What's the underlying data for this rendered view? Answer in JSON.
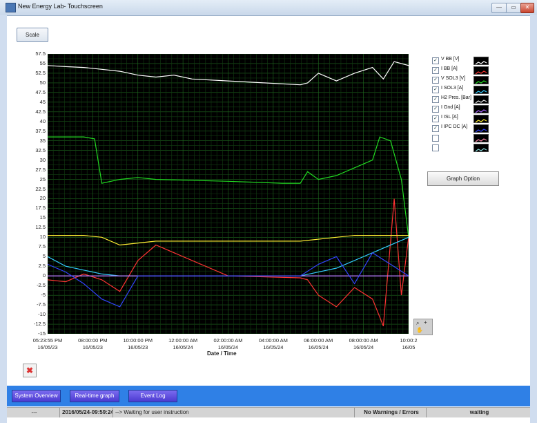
{
  "window": {
    "title": "New Energy Lab- Touchscreen",
    "min": "—",
    "max": "▭",
    "close": "✕"
  },
  "toolbar": {
    "scale_label": "Scale"
  },
  "chart_data": {
    "type": "line",
    "xlabel": "Date / Time",
    "ylim": [
      -15,
      57.5
    ],
    "yticks": [
      "57.5",
      "55",
      "52.5",
      "50",
      "47.5",
      "45",
      "42.5",
      "40",
      "37.5",
      "35",
      "32.5",
      "30",
      "27.5",
      "25",
      "22.5",
      "20",
      "17.5",
      "15",
      "12.5",
      "10",
      "7.5",
      "5",
      "2.5",
      "0",
      "-2.5",
      "-5",
      "-7.5",
      "-10",
      "-12.5",
      "-15"
    ],
    "xticks": [
      {
        "time": "05:23:55 PM",
        "date": "16/05/23"
      },
      {
        "time": "08:00:00 PM",
        "date": "16/05/23"
      },
      {
        "time": "10:00:00 PM",
        "date": "16/05/23"
      },
      {
        "time": "12:00:00 AM",
        "date": "16/05/24"
      },
      {
        "time": "02:00:00 AM",
        "date": "16/05/24"
      },
      {
        "time": "04:00:00 AM",
        "date": "16/05/24"
      },
      {
        "time": "06:00:00 AM",
        "date": "16/05/24"
      },
      {
        "time": "08:00:00 AM",
        "date": "16/05/24"
      },
      {
        "time": "10:00:2",
        "date": "16/05"
      }
    ],
    "series": [
      {
        "name": "V BB [V]",
        "color": "#ffffff",
        "x": [
          0,
          0.05,
          0.1,
          0.15,
          0.2,
          0.25,
          0.3,
          0.35,
          0.4,
          0.5,
          0.6,
          0.7,
          0.72,
          0.75,
          0.8,
          0.85,
          0.9,
          0.93,
          0.96,
          1.0
        ],
        "values": [
          54.5,
          54.2,
          54.0,
          53.5,
          53.0,
          52.0,
          51.5,
          52.0,
          51.0,
          50.5,
          50.0,
          49.5,
          50.0,
          52.5,
          50.5,
          52.5,
          54.0,
          51.0,
          55.5,
          54.5
        ]
      },
      {
        "name": "I BB [A]",
        "color": "#ff3333",
        "x": [
          0,
          0.05,
          0.1,
          0.15,
          0.2,
          0.25,
          0.3,
          0.5,
          0.7,
          0.72,
          0.75,
          0.8,
          0.85,
          0.9,
          0.93,
          0.96,
          0.98,
          1.0
        ],
        "values": [
          -1,
          -1.5,
          0.5,
          -1,
          -4,
          4,
          8,
          0,
          -0.5,
          -1,
          -5,
          -8,
          -3,
          -6,
          -13,
          20,
          -5,
          10
        ]
      },
      {
        "name": "V SOL3 [V]",
        "color": "#22dd22",
        "x": [
          0,
          0.05,
          0.1,
          0.13,
          0.15,
          0.2,
          0.25,
          0.3,
          0.5,
          0.65,
          0.7,
          0.72,
          0.75,
          0.8,
          0.85,
          0.9,
          0.92,
          0.95,
          0.98,
          1.0
        ],
        "values": [
          36,
          36,
          36,
          35.5,
          24,
          25,
          25.5,
          25,
          24.5,
          24,
          24,
          27,
          25,
          26,
          28,
          30,
          36,
          35,
          25,
          10
        ]
      },
      {
        "name": "I SOL3 [A]",
        "color": "#33ccff",
        "x": [
          0,
          0.05,
          0.1,
          0.15,
          0.2,
          0.3,
          0.5,
          0.7,
          0.75,
          0.8,
          0.9,
          1.0
        ],
        "values": [
          5,
          2.5,
          1.5,
          0.5,
          0,
          0,
          0,
          0,
          1,
          2,
          6,
          10
        ]
      },
      {
        "name": "H2 Pres. [Bar]",
        "color": "#e8e8e8",
        "x": [
          0,
          1
        ],
        "values": [
          0,
          0
        ]
      },
      {
        "name": "I Gnd [A]",
        "color": "#aa66ff",
        "x": [
          0,
          1
        ],
        "values": [
          0,
          0
        ]
      },
      {
        "name": "I ISL [A]",
        "color": "#ffee33",
        "x": [
          0,
          0.1,
          0.15,
          0.2,
          0.3,
          0.5,
          0.7,
          0.8,
          0.85,
          0.9,
          1.0
        ],
        "values": [
          10.5,
          10.5,
          10,
          8,
          9,
          9,
          9,
          10,
          10.5,
          10.5,
          10.5
        ]
      },
      {
        "name": "I IPC DC [A]",
        "color": "#3344ff",
        "x": [
          0,
          0.05,
          0.1,
          0.15,
          0.2,
          0.25,
          0.3,
          0.5,
          0.7,
          0.75,
          0.8,
          0.85,
          0.9,
          0.95,
          1.0
        ],
        "values": [
          3,
          1,
          -2,
          -6,
          -8,
          0,
          0,
          0,
          0,
          3,
          5,
          -2,
          6,
          3,
          0
        ]
      }
    ],
    "grid": true,
    "background": "#000000"
  },
  "legend": [
    {
      "label": "V BB [V]",
      "checked": true,
      "color": "#ffffff"
    },
    {
      "label": "I BB [A]",
      "checked": true,
      "color": "#ff3333"
    },
    {
      "label": "V SOL3 [V]",
      "checked": true,
      "color": "#22dd22"
    },
    {
      "label": "I SOL3 [A]",
      "checked": true,
      "color": "#33ccff"
    },
    {
      "label": "H2 Pres. [Bar]",
      "checked": true,
      "color": "#e8e8e8"
    },
    {
      "label": "I Gnd [A]",
      "checked": true,
      "color": "#aa66ff"
    },
    {
      "label": "I ISL [A]",
      "checked": true,
      "color": "#ffee33"
    },
    {
      "label": "I IPC DC [A]",
      "checked": true,
      "color": "#3344ff"
    },
    {
      "label": "",
      "checked": false,
      "color": "#ff88aa"
    },
    {
      "label": "",
      "checked": false,
      "color": "#88dddd"
    }
  ],
  "graph_option_label": "Graph Option",
  "nav": {
    "system_overview": "System Overview",
    "realtime_graph": "Real-time graph",
    "event_log": "Event Log"
  },
  "status": {
    "cell1": "---",
    "timestamp": "2016/05/24-09:59:24",
    "message": "--> Waiting for user instruction",
    "warnings": "No Warnings / Errors",
    "state": "waiting"
  }
}
